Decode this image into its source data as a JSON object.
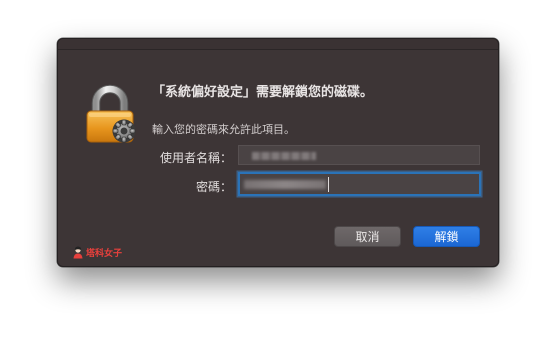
{
  "dialog": {
    "title": "「系統偏好設定」需要解鎖您的磁碟。",
    "subtitle": "輸入您的密碼來允許此項目。",
    "username_label": "使用者名稱：",
    "password_label": "密碼：",
    "cancel_label": "取消",
    "unlock_label": "解鎖",
    "lock_icon": "padlock-with-gear-icon"
  },
  "watermark": {
    "text": "塔科女子"
  },
  "colors": {
    "dialog_background": "#3d3536",
    "primary_button": "#1b67d4",
    "focus_ring": "#2a73b8",
    "watermark": "#e8403c"
  }
}
